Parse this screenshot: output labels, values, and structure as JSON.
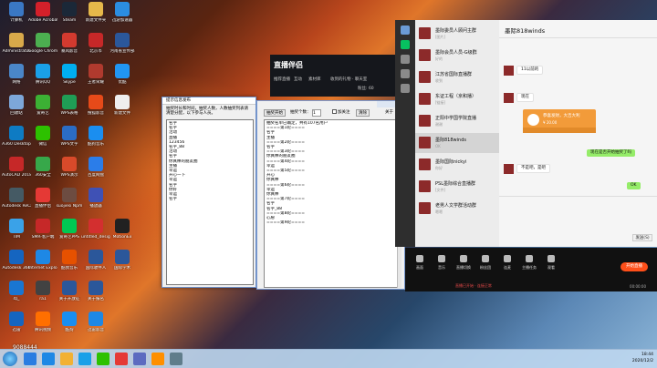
{
  "desktop": {
    "icons": [
      {
        "label": "计算机",
        "icon": "computer-icon",
        "color": "#3a78c4",
        "col": 0,
        "row": 0
      },
      {
        "label": "Adobe Acrobat DC",
        "icon": "acrobat-icon",
        "color": "#d4202a",
        "col": 1,
        "row": 0
      },
      {
        "label": "Steam",
        "icon": "steam-icon",
        "color": "#1b2838",
        "col": 2,
        "row": 0
      },
      {
        "label": "新建文件夹",
        "icon": "folder-icon",
        "color": "#e6b84a",
        "col": 3,
        "row": 0
      },
      {
        "label": "迅游加速器",
        "icon": "app-icon",
        "color": "#2b8de0",
        "col": 4,
        "row": 0
      },
      {
        "label": "Administrator",
        "icon": "user-folder-icon",
        "color": "#d8a94a",
        "col": 0,
        "row": 1
      },
      {
        "label": "Google Chrome",
        "icon": "chrome-icon",
        "color": "#4caf50",
        "col": 1,
        "row": 1
      },
      {
        "label": "暴风影音",
        "icon": "media-icon",
        "color": "#d33a2f",
        "col": 2,
        "row": 1
      },
      {
        "label": "北京市",
        "icon": "doc-icon",
        "color": "#c62828",
        "col": 3,
        "row": 1
      },
      {
        "label": "河南省宣传部",
        "icon": "word-icon",
        "color": "#2b579a",
        "col": 4,
        "row": 1
      },
      {
        "label": "网络",
        "icon": "network-icon",
        "color": "#4a86c8",
        "col": 0,
        "row": 2
      },
      {
        "label": "腾讯QQ",
        "icon": "qq-icon",
        "color": "#1aa0e8",
        "col": 1,
        "row": 2
      },
      {
        "label": "Skype",
        "icon": "skype-icon",
        "color": "#00aff0",
        "col": 2,
        "row": 2
      },
      {
        "label": "王者荣耀",
        "icon": "game-icon",
        "color": "#b03a2e",
        "col": 3,
        "row": 2
      },
      {
        "label": "优酷",
        "icon": "youku-icon",
        "color": "#2196f3",
        "col": 4,
        "row": 2
      },
      {
        "label": "回收站",
        "icon": "recycle-bin-icon",
        "color": "#7da7d9",
        "col": 0,
        "row": 3
      },
      {
        "label": "爱奇艺",
        "icon": "iqiyi-icon",
        "color": "#3cb034",
        "col": 1,
        "row": 3
      },
      {
        "label": "WPS表格",
        "icon": "wps-sheet-icon",
        "color": "#1f9d55",
        "col": 2,
        "row": 3
      },
      {
        "label": "搜狐影音",
        "icon": "sohu-icon",
        "color": "#e64a19",
        "col": 3,
        "row": 3
      },
      {
        "label": "新建文件",
        "icon": "file-icon",
        "color": "#eeeeee",
        "col": 4,
        "row": 3
      },
      {
        "label": "A360 Desktop",
        "icon": "a360-icon",
        "color": "#0e7bc3",
        "col": 0,
        "row": 4
      },
      {
        "label": "微信",
        "icon": "wechat-icon",
        "color": "#2dc100",
        "col": 1,
        "row": 4
      },
      {
        "label": "WPS文字",
        "icon": "wps-writer-icon",
        "color": "#2b6cc4",
        "col": 2,
        "row": 4
      },
      {
        "label": "酷狗音乐",
        "icon": "kugou-icon",
        "color": "#1a8ef0",
        "col": 3,
        "row": 4
      },
      {
        "label": "AutoCAD 2018",
        "icon": "autocad-icon",
        "color": "#c62828",
        "col": 0,
        "row": 5
      },
      {
        "label": "360安全",
        "icon": "shield-icon",
        "color": "#37a84a",
        "col": 1,
        "row": 5
      },
      {
        "label": "WPS演示",
        "icon": "wps-ppt-icon",
        "color": "#d84a2a",
        "col": 2,
        "row": 5
      },
      {
        "label": "百度网盘",
        "icon": "baidu-icon",
        "color": "#2b7de9",
        "col": 3,
        "row": 5
      },
      {
        "label": "Autodesk ReCap",
        "icon": "recap-icon",
        "color": "#455a64",
        "col": 0,
        "row": 6
      },
      {
        "label": "直播伴侣",
        "icon": "live-icon",
        "color": "#e53935",
        "col": 1,
        "row": 6
      },
      {
        "label": "suojiesi Npm",
        "icon": "npm-icon",
        "color": "#6d4c41",
        "col": 2,
        "row": 6
      },
      {
        "label": "播放器",
        "icon": "player-icon",
        "color": "#3f51b5",
        "col": 3,
        "row": 6
      },
      {
        "label": "TIM",
        "icon": "tim-icon",
        "color": "#3aa2e8",
        "col": 0,
        "row": 7
      },
      {
        "label": "SMR-客户端",
        "icon": "smr-icon",
        "color": "#c62828",
        "col": 1,
        "row": 7
      },
      {
        "label": "爱奇艺PPS",
        "icon": "pps-icon",
        "color": "#00c853",
        "col": 2,
        "row": 7
      },
      {
        "label": "untitled_design",
        "icon": "design-icon",
        "color": "#d32f2f",
        "col": 3,
        "row": 7
      },
      {
        "label": "MotionEx",
        "icon": "motion-icon",
        "color": "#212121",
        "col": 4,
        "row": 7
      },
      {
        "label": "Autodesk 360",
        "icon": "cloud-icon",
        "color": "#1565c0",
        "col": 0,
        "row": 8
      },
      {
        "label": "Internet Explorer",
        "icon": "ie-icon",
        "color": "#1e88e5",
        "col": 1,
        "row": 8
      },
      {
        "label": "酷我音乐",
        "icon": "kuwo-icon",
        "color": "#e65100",
        "col": 2,
        "row": 8
      },
      {
        "label": "国际收件人",
        "icon": "word-icon",
        "color": "#2b579a",
        "col": 3,
        "row": 8
      },
      {
        "label": "国际学术",
        "icon": "word-icon",
        "color": "#2b579a",
        "col": 4,
        "row": 8
      },
      {
        "label": "4汇",
        "icon": "app-icon",
        "color": "#1976d2",
        "col": 0,
        "row": 9
      },
      {
        "label": "ra1",
        "icon": "app-icon",
        "color": "#424242",
        "col": 1,
        "row": 9
      },
      {
        "label": "关于开放征",
        "icon": "word-icon",
        "color": "#2b579a",
        "col": 2,
        "row": 9
      },
      {
        "label": "关于报名",
        "icon": "word-icon",
        "color": "#2b579a",
        "col": 3,
        "row": 9
      },
      {
        "label": "迅雷",
        "icon": "xunlei-icon",
        "color": "#1565c0",
        "col": 0,
        "row": 10
      },
      {
        "label": "腾讯视频",
        "icon": "video-icon",
        "color": "#ff6f00",
        "col": 1,
        "row": 10
      },
      {
        "label": "酷狗",
        "icon": "kugou-icon",
        "color": "#1a8ef0",
        "col": 2,
        "row": 10
      },
      {
        "label": "迅雷影音",
        "icon": "media-icon",
        "color": "#1e88e5",
        "col": 3,
        "row": 10
      }
    ],
    "bottom_number": "9088444"
  },
  "stream_banner": {
    "logo": "直播伴侣",
    "menu_items": [
      "推荐直播",
      "互动",
      "素材库",
      "收到的礼物 · 聊天室"
    ],
    "extra": "粉丝: 60"
  },
  "dialog": {
    "title": "提示信息发布",
    "description": "抽奖时长和时间，抽奖人数，人数抽奖列表请清楚分配，以下参与人员。",
    "list": [
      "名字",
      "名字",
      "活动",
      "直播",
      "123456",
      "名字_88",
      "活动",
      "名字",
      "你真棒的朋友圈",
      "主播",
      "幸运",
      "开心一下",
      "幸运",
      "名字",
      "你好",
      "幸运",
      "名字"
    ]
  },
  "mainwin": {
    "toolbar": {
      "button1": "抽奖开始",
      "count_label": "抽奖个数：",
      "count_value": "1",
      "check_label": "加关注",
      "button2": "清除",
      "button3": "关于"
    },
    "rows": [
      "抽奖名单已确定，共有107名用户",
      "====第1轮====",
      "名字",
      "主播",
      "====第2轮====",
      "名字",
      "====第3轮====",
      "你真棒的朋友圈",
      "====第4轮====",
      "幸运",
      "====第5轮====",
      "开心",
      "你真棒",
      "====第6轮====",
      "幸运",
      "你真棒",
      "====第7轮====",
      "名字",
      "名字_88",
      "====第8轮====",
      "心愿",
      "====第9轮===="
    ]
  },
  "chat": {
    "title": "墨际818winds",
    "conversations": [
      {
        "name": "墨际委员人顾问主群",
        "snippet": "[图片]"
      },
      {
        "name": "墨际会员人员-G级群",
        "snippet": "好的"
      },
      {
        "name": "江苏省国际直播群",
        "snippet": "收到"
      },
      {
        "name": "东证工程（京和播）",
        "snippet": "[链接]"
      },
      {
        "name": "正阳中学国学院直播",
        "snippet": "谢谢"
      },
      {
        "name": "墨际818winds",
        "snippet": "OK"
      },
      {
        "name": "墨际国际nickyi",
        "snippet": "你好"
      },
      {
        "name": "PSL墨际综合直播群",
        "snippet": "[文件]"
      },
      {
        "name": "老男人文学群活动群",
        "snippet": "嗯嗯"
      }
    ],
    "messages": [
      {
        "side": "in",
        "text": "11以前的"
      },
      {
        "side": "in",
        "text": "现在"
      },
      {
        "side": "out",
        "text": "现在是否开始抽奖了吗"
      },
      {
        "side": "in",
        "text": "不是吧，是吧"
      },
      {
        "side": "out",
        "text": "OK"
      }
    ],
    "red_packet": {
      "title": "恭喜发财，大吉大利",
      "amount": "¥ 20.00"
    },
    "send_label": "发送(S)"
  },
  "live_panel": {
    "tools": [
      "画面",
      "音乐",
      "直播切换",
      "粉丝团",
      "连麦",
      "主播任务",
      "观看"
    ],
    "start_label": "开始直播",
    "status": "直播已开始 · 连接正常",
    "timer": "00:00:00"
  },
  "taskbar": {
    "clock": "18:44",
    "date": "2020/12/2"
  }
}
